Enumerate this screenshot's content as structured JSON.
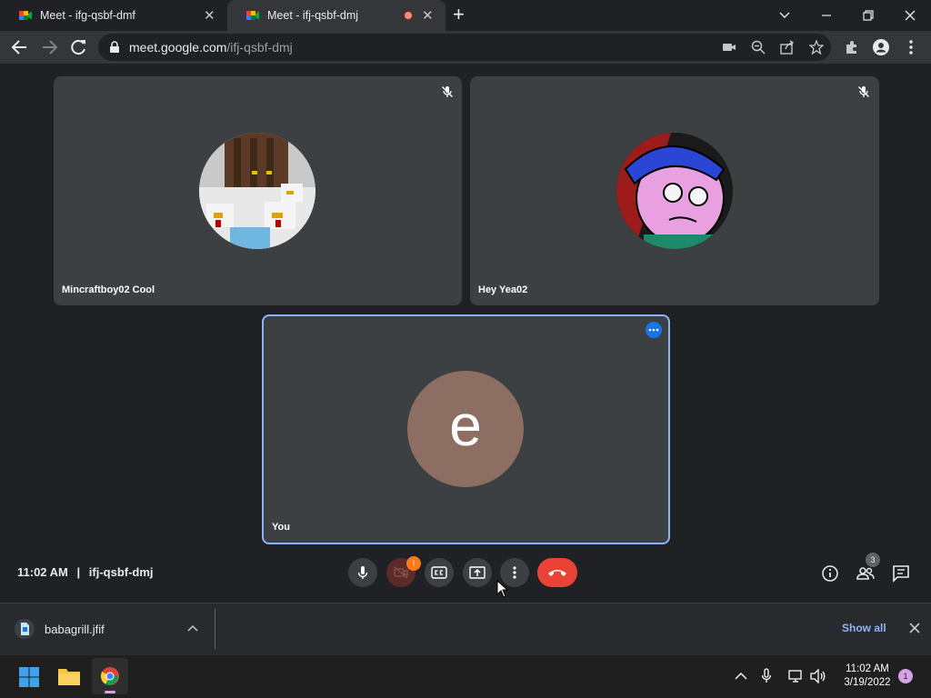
{
  "browser": {
    "tabs": [
      {
        "title": "Meet - ifg-qsbf-dmf",
        "active": false
      },
      {
        "title": "Meet - ifj-qsbf-dmj",
        "active": true
      }
    ],
    "url_domain": "meet.google.com",
    "url_path": "/ifj-qsbf-dmj"
  },
  "meet": {
    "participants": [
      {
        "name": "Mincraftboy02 Cool",
        "muted": true
      },
      {
        "name": "Hey Yea02",
        "muted": true
      },
      {
        "name": "You",
        "initial": "e",
        "avatar_color": "#8d6e63"
      }
    ],
    "time": "11:02 AM",
    "separator": "|",
    "meeting_code": "ifj-qsbf-dmj",
    "camera_alert_count": "!",
    "people_count": "3",
    "accent_color": "#8ab4f8",
    "end_call_color": "#ea4335"
  },
  "downloads": {
    "file_name": "babagrill.jfif",
    "show_all": "Show all"
  },
  "taskbar": {
    "time": "11:02 AM",
    "date": "3/19/2022",
    "notification_count": "1"
  }
}
